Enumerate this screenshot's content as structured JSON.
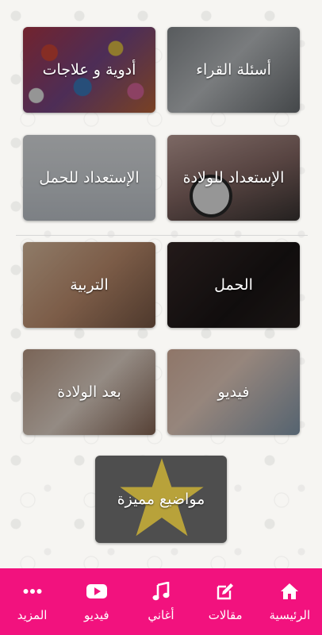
{
  "tiles": {
    "readers_questions": "أسئلة القراء",
    "medicines": "أدوية و علاجات",
    "birth_prep": "الإستعداد للولادة",
    "pregnancy_prep": "الإستعداد للحمل",
    "pregnancy": "الحمل",
    "parenting": "التربية",
    "video": "فيديو",
    "after_birth": "بعد الولادة",
    "featured": "مواضيع مميزة"
  },
  "nav": {
    "home": "الرئيسية",
    "articles": "مقالات",
    "songs": "أغاني",
    "video": "فيديو",
    "more": "المزيد"
  },
  "icons": {
    "home": "home-icon",
    "articles": "edit-icon",
    "songs": "music-icon",
    "video": "youtube-icon",
    "more": "more-dots-icon"
  },
  "colors": {
    "nav_background": "#f2127e",
    "featured_star": "#b8a23a"
  }
}
